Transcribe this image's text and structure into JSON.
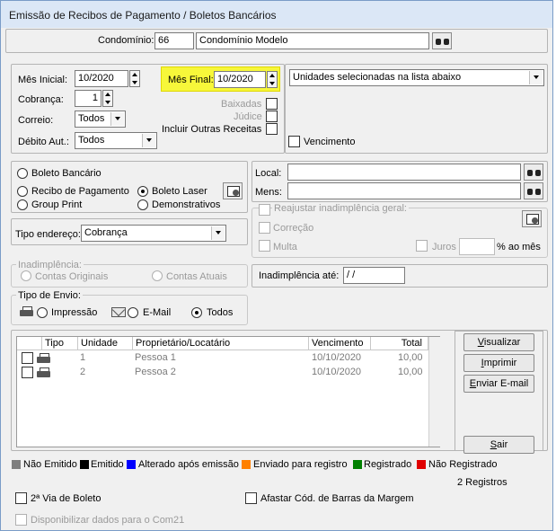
{
  "window": {
    "title": "Emissão de Recibos de Pagamento / Boletos Bancários"
  },
  "condominio": {
    "label": "Condomínio:",
    "code": "66",
    "name": "Condomínio Modelo"
  },
  "filters": {
    "mes_inicial_label": "Mês Inicial:",
    "mes_inicial": "10/2020",
    "mes_final_label": "Mês Final:",
    "mes_final": "10/2020",
    "cobranca_label": "Cobrança:",
    "cobranca": "1",
    "correio_label": "Correio:",
    "correio": "Todos",
    "debito_label": "Débito Aut.:",
    "debito": "Todos",
    "baixadas_label": "Baixadas",
    "judice_label": "Júdice",
    "outras_receitas_label": "Incluir Outras Receitas",
    "unidades_select": "Unidades selecionadas na lista abaixo",
    "vencimento_label": "Vencimento"
  },
  "doc_type": {
    "boleto_bancario": "Boleto Bancário",
    "recibo": "Recibo de Pagamento",
    "boleto_laser": "Boleto Laser",
    "group_print": "Group Print",
    "demonstrativos": "Demonstrativos",
    "selected": "Boleto Laser"
  },
  "local": {
    "local_label": "Local:",
    "mens_label": "Mens:"
  },
  "tipo_endereco": {
    "label": "Tipo endereço:",
    "value": "Cobrança"
  },
  "reajuste": {
    "title": "Reajustar inadimplência geral:",
    "correcao": "Correção",
    "multa": "Multa",
    "juros": "Juros",
    "ao_mes": "% ao mês"
  },
  "inadimplencia": {
    "title": "Inadimplência:",
    "originais": "Contas Originais",
    "atuais": "Contas Atuais",
    "ate_label": "Inadimplência até:",
    "ate_value": " / /"
  },
  "envio": {
    "title": "Tipo de Envio:",
    "impressao": "Impressão",
    "email": "E-Mail",
    "todos": "Todos",
    "selected": "Todos"
  },
  "table": {
    "columns": [
      "Tipo",
      "Unidade",
      "Proprietário/Locatário",
      "Vencimento",
      "Total"
    ],
    "rows": [
      {
        "unidade": "1",
        "nome": "Pessoa 1",
        "vencimento": "10/10/2020",
        "total": "10,00",
        "icon": "printer-icon"
      },
      {
        "unidade": "2",
        "nome": "Pessoa 2",
        "vencimento": "10/10/2020",
        "total": "10,00",
        "icon": "printer-icon"
      }
    ]
  },
  "actions": {
    "visualizar": "Visualizar",
    "imprimir": "Imprimir",
    "enviar": "Enviar E-mail",
    "sair": "Sair"
  },
  "legend": [
    {
      "label": "Não Emitido",
      "color": "#7f7f7f"
    },
    {
      "label": "Emitido",
      "color": "#000000"
    },
    {
      "label": "Alterado após emissão",
      "color": "#0000ff"
    },
    {
      "label": "Enviado para registro",
      "color": "#ff8000"
    },
    {
      "label": "Registrado",
      "color": "#008000"
    },
    {
      "label": "Não Registrado",
      "color": "#e00000"
    }
  ],
  "footer": {
    "registros": "2 Registros",
    "segunda_via": "2ª Via de Boleto",
    "afastar": "Afastar Cód. de Barras da Margem",
    "com21": "Disponibilizar dados para o Com21"
  }
}
